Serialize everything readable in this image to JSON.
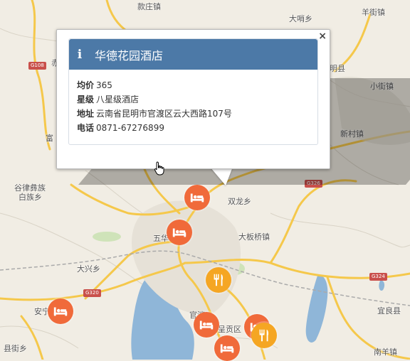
{
  "map": {
    "place_labels": [
      "款庄镇",
      "大哨乡",
      "羊街镇",
      "小街镇",
      "谷律彝族",
      "白族乡",
      "大兴乡",
      "安宁",
      "县街乡",
      "五华",
      "双龙乡",
      "大板桥镇",
      "呈贡区",
      "宜良县",
      "南羊镇",
      "富",
      "明县",
      "新村镇",
      "官渡",
      "赤"
    ],
    "road_badges": [
      "G108",
      "G320",
      "G326",
      "G324"
    ],
    "colors": {
      "land": "#f1ede4",
      "water": "#8fb6d8",
      "road": "#f5c84b",
      "hotel": "#f06a3a",
      "food": "#f5a623"
    }
  },
  "markers": [
    {
      "type": "hotel",
      "icon": "bed-icon"
    },
    {
      "type": "hotel",
      "icon": "bed-icon"
    },
    {
      "type": "food",
      "icon": "cutlery-icon"
    },
    {
      "type": "hotel",
      "icon": "bed-icon"
    },
    {
      "type": "hotel",
      "icon": "bed-icon"
    },
    {
      "type": "hotel",
      "icon": "bed-icon"
    },
    {
      "type": "food",
      "icon": "cutlery-icon"
    }
  ],
  "popup": {
    "close": "×",
    "icon": "i",
    "title": "华德花园酒店",
    "fields": [
      {
        "key": "均价",
        "value": "365"
      },
      {
        "key": "星级",
        "value": "八星级酒店"
      },
      {
        "key": "地址",
        "value": "云南省昆明市官渡区云大西路107号"
      },
      {
        "key": "电话",
        "value": "0871-67276899"
      }
    ]
  }
}
